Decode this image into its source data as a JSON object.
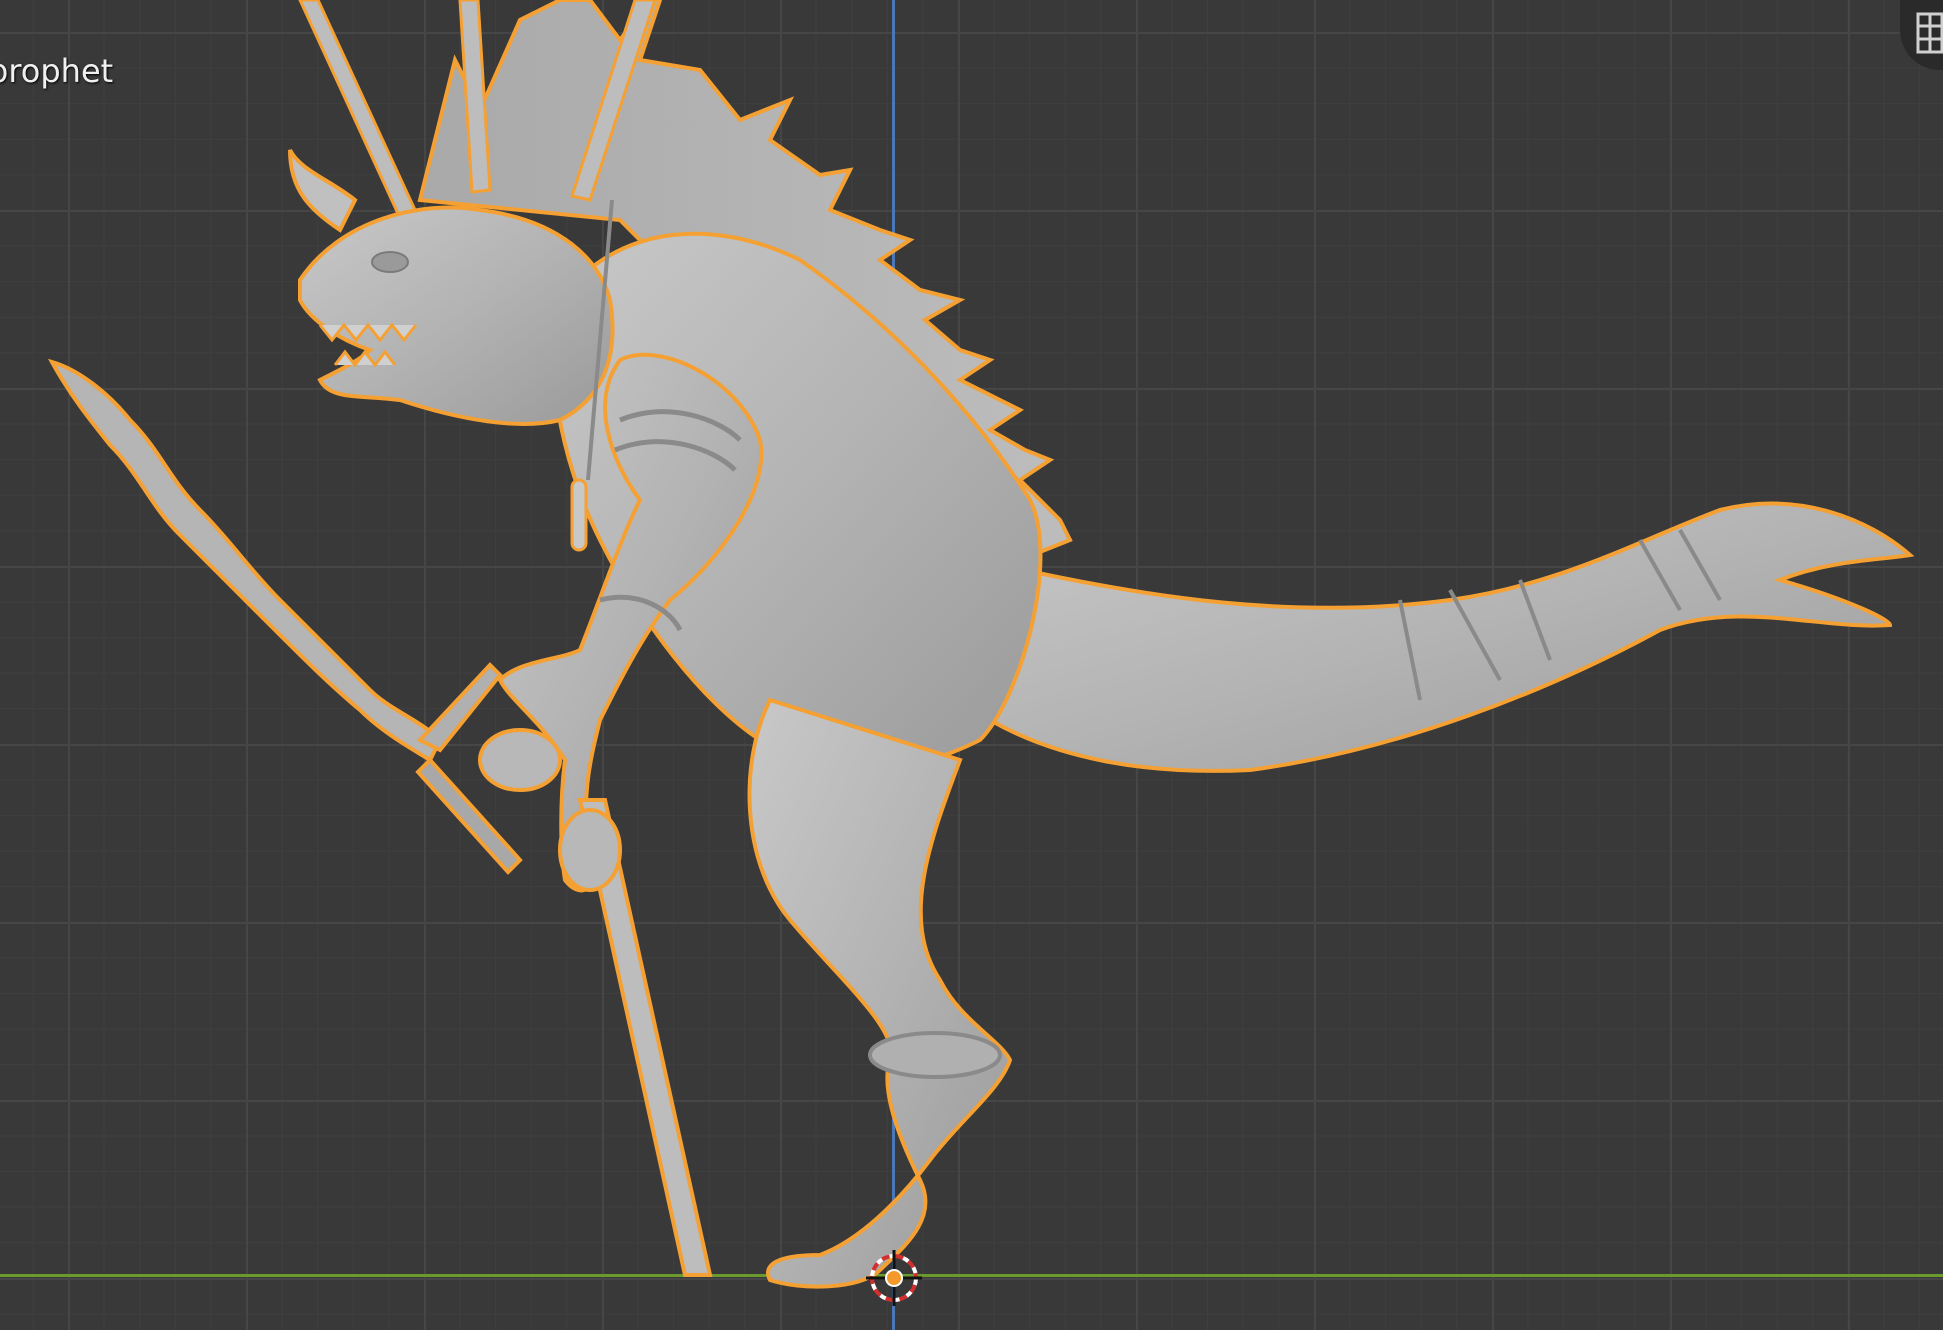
{
  "viewport": {
    "object_name": "prophet",
    "grid_color": "#464646",
    "background_color": "#393939",
    "selection_outline_color": "#f5a033",
    "z_axis_color": "#4a77b8",
    "y_axis_color": "#6a9a2c"
  },
  "model": {
    "name": "prophet",
    "selected": true,
    "shading": "solid"
  },
  "cursor": {
    "name": "3d-cursor"
  },
  "gizmo": {
    "icon": "grid-view-icon"
  }
}
